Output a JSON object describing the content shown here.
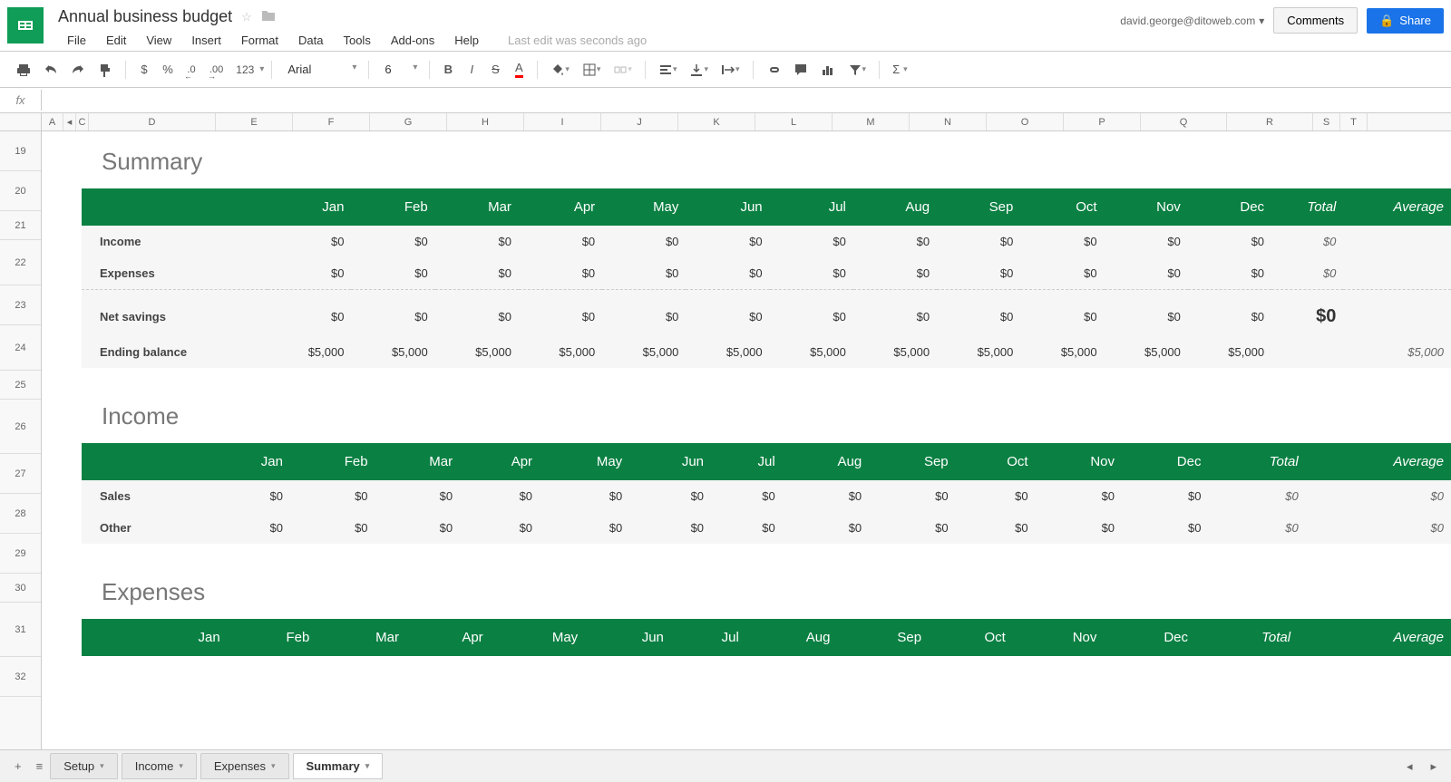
{
  "doc": {
    "title": "Annual business budget",
    "last_edit": "Last edit was seconds ago",
    "user_email": "david.george@ditoweb.com"
  },
  "menus": [
    "File",
    "Edit",
    "View",
    "Insert",
    "Format",
    "Data",
    "Tools",
    "Add-ons",
    "Help"
  ],
  "buttons": {
    "comments": "Comments",
    "share": "Share"
  },
  "toolbar": {
    "font": "Arial",
    "size": "6",
    "currency": "$",
    "percent": "%",
    "dec_dec": ".0",
    "dec_inc": ".00",
    "num_123": "123"
  },
  "formula": "",
  "col_headers": [
    "A",
    "",
    "C",
    "D",
    "E",
    "F",
    "G",
    "H",
    "I",
    "J",
    "K",
    "L",
    "M",
    "N",
    "O",
    "P",
    "Q",
    "R",
    "S",
    "T"
  ],
  "row_headers": [
    "19",
    "20",
    "21",
    "22",
    "23",
    "24",
    "25",
    "26",
    "27",
    "28",
    "29",
    "30",
    "31",
    "32"
  ],
  "months": [
    "Jan",
    "Feb",
    "Mar",
    "Apr",
    "May",
    "Jun",
    "Jul",
    "Aug",
    "Sep",
    "Oct",
    "Nov",
    "Dec"
  ],
  "agg_cols": [
    "Total",
    "Average"
  ],
  "sections": {
    "summary": {
      "title": "Summary",
      "rows": [
        {
          "label": "Income",
          "values": [
            "$0",
            "$0",
            "$0",
            "$0",
            "$0",
            "$0",
            "$0",
            "$0",
            "$0",
            "$0",
            "$0",
            "$0"
          ],
          "total": "$0",
          "average": ""
        },
        {
          "label": "Expenses",
          "values": [
            "$0",
            "$0",
            "$0",
            "$0",
            "$0",
            "$0",
            "$0",
            "$0",
            "$0",
            "$0",
            "$0",
            "$0"
          ],
          "total": "$0",
          "average": ""
        }
      ],
      "rows2": [
        {
          "label": "Net savings",
          "values": [
            "$0",
            "$0",
            "$0",
            "$0",
            "$0",
            "$0",
            "$0",
            "$0",
            "$0",
            "$0",
            "$0",
            "$0"
          ],
          "total": "$0",
          "total_bold": true,
          "average": ""
        },
        {
          "label": "Ending balance",
          "values": [
            "$5,000",
            "$5,000",
            "$5,000",
            "$5,000",
            "$5,000",
            "$5,000",
            "$5,000",
            "$5,000",
            "$5,000",
            "$5,000",
            "$5,000",
            "$5,000"
          ],
          "total": "",
          "average": "$5,000"
        }
      ]
    },
    "income": {
      "title": "Income",
      "rows": [
        {
          "label": "Sales",
          "values": [
            "$0",
            "$0",
            "$0",
            "$0",
            "$0",
            "$0",
            "$0",
            "$0",
            "$0",
            "$0",
            "$0",
            "$0"
          ],
          "total": "$0",
          "average": "$0"
        },
        {
          "label": "Other",
          "values": [
            "$0",
            "$0",
            "$0",
            "$0",
            "$0",
            "$0",
            "$0",
            "$0",
            "$0",
            "$0",
            "$0",
            "$0"
          ],
          "total": "$0",
          "average": "$0"
        }
      ]
    },
    "expenses": {
      "title": "Expenses"
    }
  },
  "sheet_tabs": [
    "Setup",
    "Income",
    "Expenses",
    "Summary"
  ],
  "active_tab": "Summary"
}
